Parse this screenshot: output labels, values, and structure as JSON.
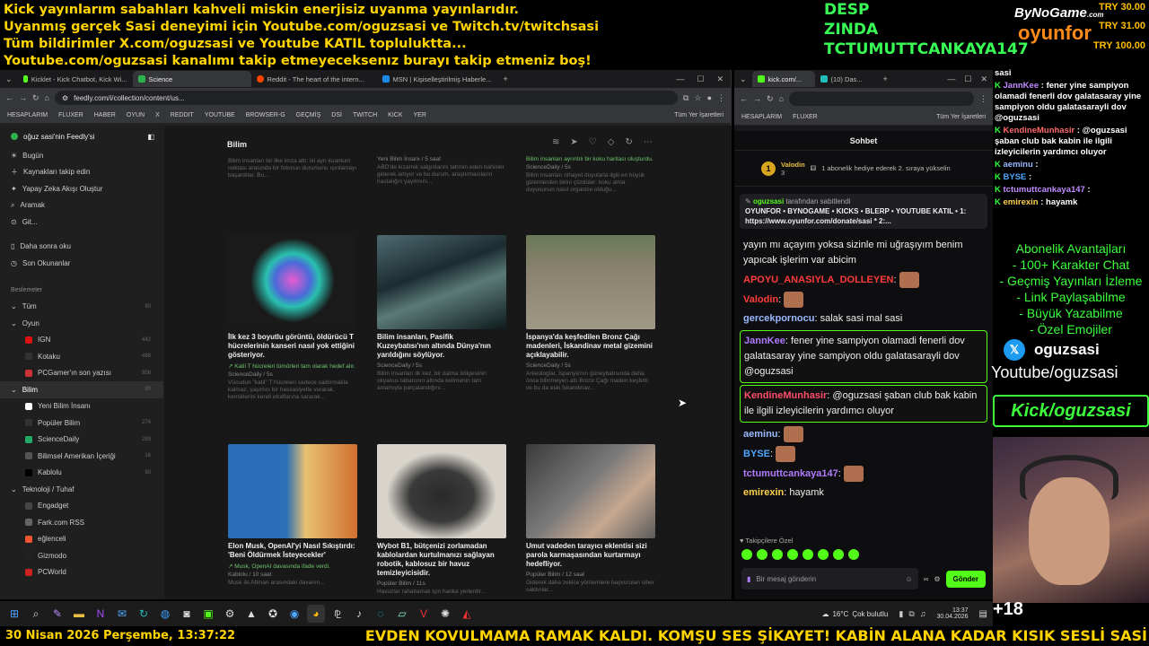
{
  "banner": {
    "lines": [
      "Kick yayınlarım sabahları kahveli miskin enerjisiz uyanma yayınlarıdır.",
      "Uyanmış gerçek Sasi deneyimi için Youtube.com/oguzsasi ve Twitch.tv/twitchsasi",
      "Tüm bildirimler X.com/oguzsasi ve Youtube KATIL topluluktta...",
      "Youtube.com/oguzsasi kanalımı takip etmeyeceksenız burayı takip etmeniz boş!"
    ]
  },
  "topcenter": {
    "l1": "DESP",
    "l2": "ZINDA",
    "l3": "TCTUMUTTCANKAYA147"
  },
  "sponsors": {
    "bynogame": "ByNoGame",
    "oyunfor": "oyunfor",
    "com": ".com",
    "try1": "TRY 30.00",
    "try2": "TRY 31.00",
    "try3": "TRY 100.00"
  },
  "browserL": {
    "tabs": [
      {
        "label": "Kicklet - Kick Chatbot, Kick Wi...",
        "color": "#53fc18"
      },
      {
        "label": "Science",
        "color": "#2bb24c"
      },
      {
        "label": "Reddit - The heart of the intern...",
        "color": "#ff4500"
      },
      {
        "label": "MSN | Kişiselleştirilmiş Haberle...",
        "color": "#1e88e5"
      }
    ],
    "url": "feedly.com/i/collection/content/us...",
    "bookmarks": [
      "HESAPLARIM",
      "FLUXER",
      "HABER",
      "OYUN",
      "X",
      "REDDIT",
      "YOUTUBE",
      "BROWSER-G",
      "GEÇMİŞ",
      "DSİ",
      "TWITCH",
      "KICK",
      "YER",
      "Tüm Yer İşaretleri"
    ]
  },
  "sidebar": {
    "user": "oğuz sasi'nin Feedly'si",
    "top": [
      "Bugün",
      "Kaynakları takip edin",
      "Yapay Zeka Akışı Oluştur",
      "Aramak",
      "Git..."
    ],
    "mid": [
      "Daha sonra oku",
      "Son Okunanlar"
    ],
    "feeds_header": "Beslemeler",
    "feeds": [
      {
        "label": "Tüm",
        "count": "90",
        "level": 0
      },
      {
        "label": "Oyun",
        "count": "",
        "level": 0
      },
      {
        "label": "IGN",
        "count": "442",
        "level": 1,
        "color": "#d11"
      },
      {
        "label": "Kotaku",
        "count": "488",
        "level": 1,
        "color": "#333"
      },
      {
        "label": "PCGamer'ın son yazısı",
        "count": "958",
        "level": 1,
        "color": "#c33"
      },
      {
        "label": "Bilim",
        "count": "90",
        "level": 0,
        "selected": true
      },
      {
        "label": "Yeni Bilim İnsanı",
        "count": "",
        "level": 1,
        "color": "#fff"
      },
      {
        "label": "Popüler Bilim",
        "count": "274",
        "level": 1,
        "color": "#333"
      },
      {
        "label": "ScienceDaily",
        "count": "293",
        "level": 1,
        "color": "#2a6"
      },
      {
        "label": "Bilimsel Amerikan İçeriği",
        "count": "16",
        "level": 1,
        "color": "#555"
      },
      {
        "label": "Kablolu",
        "count": "90",
        "level": 1,
        "color": "#000"
      },
      {
        "label": "Teknoloji / Tuhaf",
        "count": "",
        "level": 0
      },
      {
        "label": "Engadget",
        "count": "",
        "level": 1,
        "color": "#444"
      },
      {
        "label": "Fark.com RSS",
        "count": "",
        "level": 1,
        "color": "#666"
      },
      {
        "label": "eğlenceli",
        "count": "",
        "level": 1,
        "color": "#e53"
      },
      {
        "label": "Gizmodo",
        "count": "",
        "level": 1,
        "color": "#222"
      },
      {
        "label": "PCWorld",
        "count": "",
        "level": 1,
        "color": "#c22"
      }
    ]
  },
  "feed": {
    "title": "Bilim",
    "prev": [
      {
        "e": "Bilim insanları bir ilke imza attı: iki ayrı kuantum noktası arasında bir fotonun durumunu ışınlamayı başardılar. Bu..."
      },
      {
        "s": "Yeni Bilim İnsanı / 5 saat",
        "e": "ABD'de kızamık salgınlarını tahmin eden bahisler giderek artıyor ve bu durum, araştırmacıların hastalığın yayılmını..."
      },
      {
        "g": "Bilim insanları ayrıntılı bir koku haritası oluşturdu.",
        "s": "ScienceDaily / 5s",
        "e": "Bilim insanları nihayet duyularla ilgili en büyük gizemlerden birini çözdüler: koku alma duyusunun nasıl organize olduğu..."
      }
    ],
    "articles": [
      {
        "title": "İlk kez 3 boyutlu görüntü, öldürücü T hücrelerinin kanseri nasıl yok ettiğini gösteriyor.",
        "green": "↗ Katil T hücreleri tümörleri tam olarak hedef alır.",
        "source": "ScienceDaily / 5s",
        "excerpt": "Vücudun \"katil\" T hücreleri sadece saldırmakla kalmaz, şaşırtıcı bir hassasiyetle vurarak, kemiklerini kendi etraflarına sararak..."
      },
      {
        "title": "Bilim insanları, Pasifik Kuzeybatısı'nın altında Dünya'nın yarıldığını söylüyor.",
        "green": "",
        "source": "ScienceDaily / 5s",
        "excerpt": "Bilim insanları ilk kez, bir dalma bölgesinin okyanus tabanının altında kelimenin tam anlamıyla parçalandığını..."
      },
      {
        "title": "İspanya'da keşfedilen Bronz Çağı madenleri, İskandinav metal gizemini açıklayabilir.",
        "green": "",
        "source": "ScienceDaily / 5s",
        "excerpt": "Arkeologlar, İspanya'nın güneybatısında daha önce bilinmeyen altı Bronz Çağı maden keşfetti ve bu da eski İskandinav..."
      },
      {
        "title": "Elon Musk, OpenAI'yi Nasıl Sıkıştırdı: 'Beni Öldürmek İsteyecekler'",
        "green": "↗ Musk, OpenAI davasında ifade verdi.",
        "source": "Kablolu / 10 saat",
        "excerpt": "Musk ile Altman arasındaki davanın..."
      },
      {
        "title": "Wybot B1, bütçenizi zorlamadan kablolardan kurtulmanızı sağlayan robotik, kablosuz bir havuz temizleyicisidir.",
        "green": "",
        "source": "Popüler Bilim / 11s",
        "excerpt": "Havuzlar rahatlamak için harika yerlerdir..."
      },
      {
        "title": "Umut vadeden tarayıcı eklentisi sizi parola karmaşasından kurtarmayı hedefliyor.",
        "green": "",
        "source": "Popüler Bilim / 12 saat",
        "excerpt": "Giderek daha zekice yöntemlere başvurulan siber saldırılar..."
      }
    ]
  },
  "browserR": {
    "tabs": [
      "kick.com/...",
      "(10) Das..."
    ],
    "bookmarks": [
      "HESAPLARIM",
      "FLUXER",
      "Tüm Yer İşaretleri"
    ],
    "chat_title": "Sohbet",
    "sub_user": "Valodin",
    "sub_num": "3",
    "sub_text": "1 abonelik hediye ederek 2. sıraya yükselin",
    "pinned_by": "oguzsasi",
    "pinned_suffix": "tarafından sabitlendi",
    "pinned_text": "OYUNFOR • BYNOGAME • KICKS • BLERP • YOUTUBE KATIL • 1: https://www.oyunfor.com/donate/sasi * 2:...",
    "messages": [
      {
        "user": "",
        "color": "#eee",
        "text": "yayın mı açayım yoksa sizinle mi uğraşıyım benim yapıcak işlerim var abicim"
      },
      {
        "user": "APOYU_ANASIYLA_DOLLEYEN",
        "color": "#ff3b3b",
        "text": ""
      },
      {
        "user": "Valodin",
        "color": "#ff3b3b",
        "text": ""
      },
      {
        "user": "gercekpornocu",
        "color": "#9ab8ff",
        "text": "salak sasi mal sasi"
      },
      {
        "user": "JannKee",
        "color": "#b07bff",
        "text": "fener yine sampiyon olamadi fenerli dov galatasaray yine sampiyon oldu galatasarayli dov @oguzsasi",
        "box": true
      },
      {
        "user": "KendineMunhasir",
        "color": "#ff4d6a",
        "text": "@oguzsasi şaban club bak kabin ile ilgili izleyicilerin yardımcı oluyor",
        "box": true
      },
      {
        "user": "aeminu",
        "color": "#9ab8ff",
        "text": ""
      },
      {
        "user": "BYSE",
        "color": "#4da6ff",
        "text": ""
      },
      {
        "user": "tctumuttcankaya147",
        "color": "#b07bff",
        "text": ""
      },
      {
        "user": "emirexin",
        "color": "#ffd24d",
        "text": "hayamk"
      }
    ],
    "followers_label": "Takipçilere Özel",
    "input_placeholder": "Bir mesaj gönderin",
    "send": "Gönder"
  },
  "rightcol": {
    "top_word": "sasi",
    "msgs": [
      {
        "user": "JannKee",
        "text": "fener yine sampiyon olamadi fenerli dov galatasaray yine sampiyon oldu galatasarayli dov @oguzsasi",
        "color": "#c08bff"
      },
      {
        "user": "KendineMunhasir",
        "text": "@oguzsasi şaban club bak kabin ile ilgili izleyicilerin yardımcı oluyor",
        "color": "#ff6b6b"
      },
      {
        "user": "aeminu",
        "text": "",
        "color": "#9ab8ff"
      },
      {
        "user": "BYSE",
        "text": "",
        "color": "#4da6ff"
      },
      {
        "user": "tctumuttcankaya147",
        "text": "",
        "color": "#c08bff"
      },
      {
        "user": "emirexin",
        "text": "hayamk",
        "color": "#ffd24d"
      }
    ],
    "perks": [
      "Abonelik Avantajları",
      "- 100+ Karakter Chat",
      "- Geçmiş Yayınları İzleme",
      "- Link Paylaşabilme",
      "- Büyük Yazabilme",
      "- Özel Emojiler"
    ],
    "x_handle": "oguzsasi",
    "youtube": "Youtube/oguzsasi",
    "kick": "Kick/oguzsasi",
    "age": "+18"
  },
  "taskbar": {
    "temp": "16°C",
    "weather": "Çok bulutlu",
    "time": "13:37",
    "date": "30.04.2026"
  },
  "ticker": {
    "datetime": "30 Nisan 2026 Perşembe, 13:37:22",
    "text": "EVDEN KOVULMAMA RAMAK KALDI. KOMŞU SES ŞİKAYET! KABİN ALANA KADAR KISIK SESLİ SASİ"
  }
}
